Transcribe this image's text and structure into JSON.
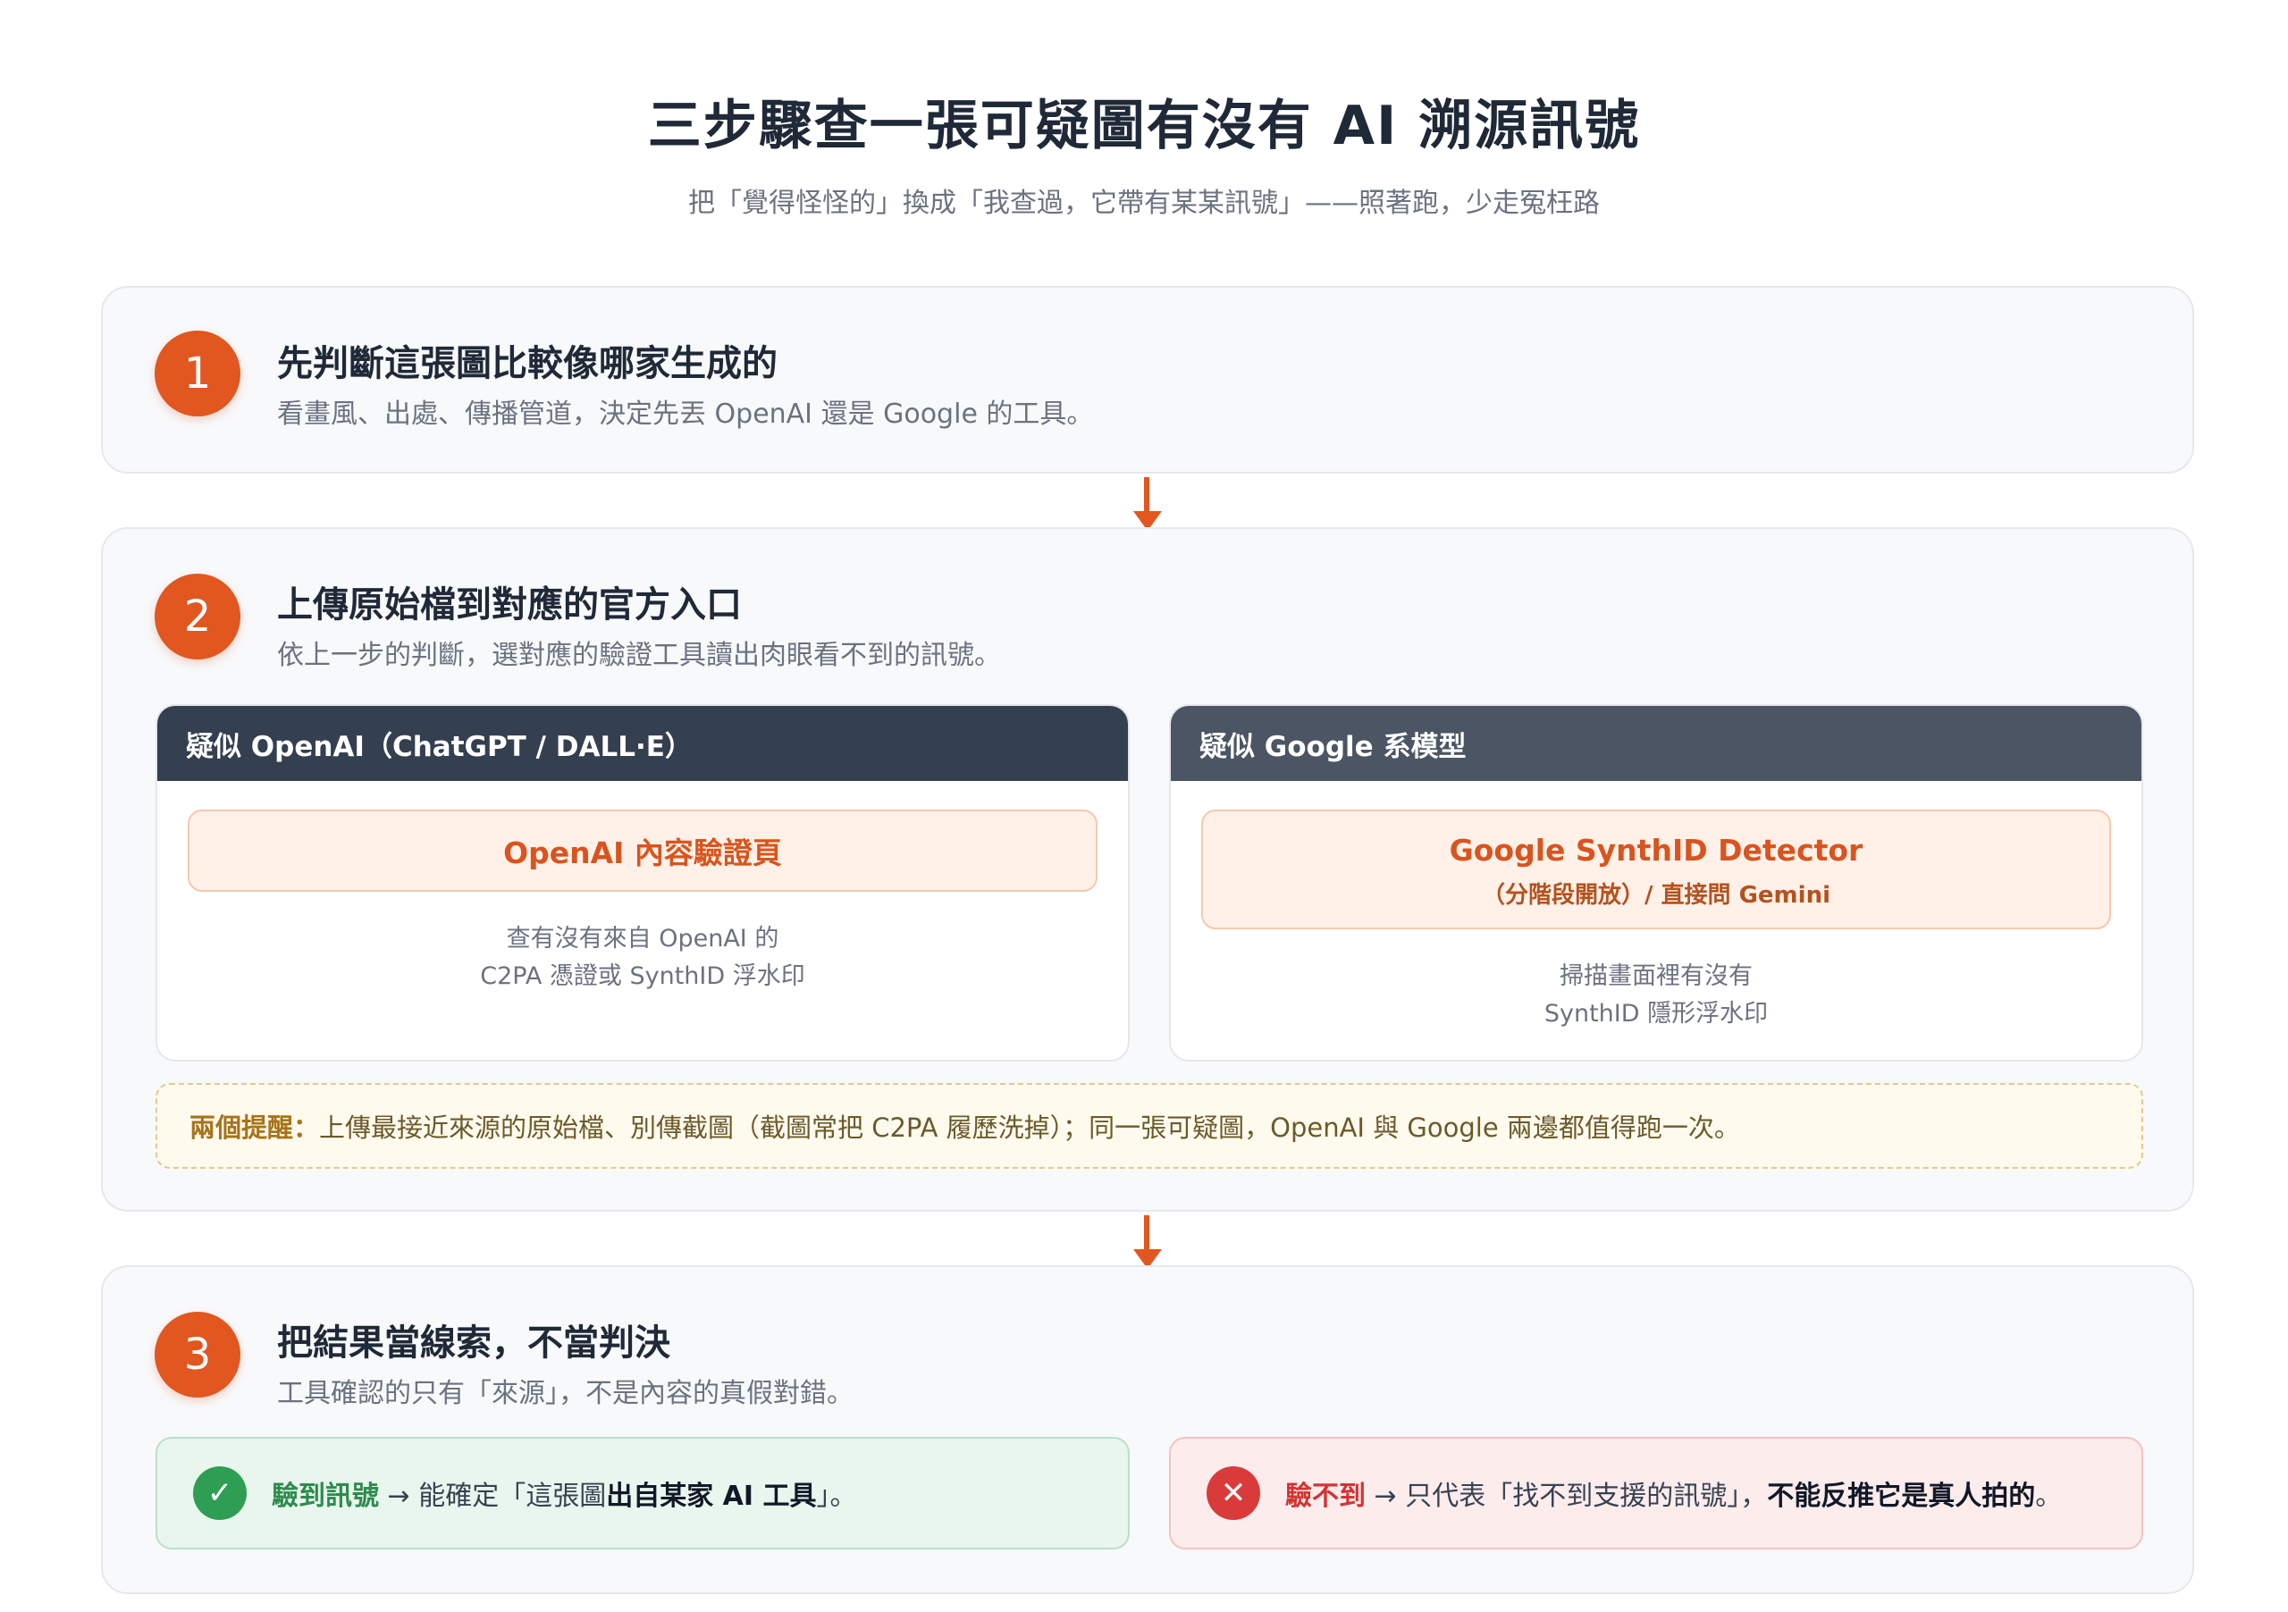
{
  "header": {
    "title": "三步驟查一張可疑圖有沒有 AI 溯源訊號",
    "subtitle": "把「覺得怪怪的」換成「我查過，它帶有某某訊號」——照著跑，少走冤枉路"
  },
  "steps": [
    {
      "number": "1",
      "title": "先判斷這張圖比較像哪家生成的",
      "desc": "看畫風、出處、傳播管道，決定先丟 OpenAI 還是 Google 的工具。"
    },
    {
      "number": "2",
      "title": "上傳原始檔到對應的官方入口",
      "desc": "依上一步的判斷，選對應的驗證工具讀出肉眼看不到的訊號。",
      "cards": [
        {
          "header": "疑似 OpenAI（ChatGPT / DALL·E）",
          "tool": "OpenAI 內容驗證頁",
          "note_line1": "查有沒有來自 OpenAI 的",
          "note_line2": "C2PA 憑證或 SynthID 浮水印"
        },
        {
          "header": "疑似 Google 系模型",
          "tool": "Google SynthID Detector",
          "tool_sub": "（分階段開放）/ 直接問 Gemini",
          "note_line1": "掃描畫面裡有沒有",
          "note_line2": "SynthID 隱形浮水印"
        }
      ],
      "reminder": {
        "lead": "兩個提醒：",
        "text": "上傳最接近來源的原始檔、別傳截圖（截圖常把 C2PA 履歷洗掉）；同一張可疑圖，OpenAI 與 Google 兩邊都值得跑一次。"
      }
    },
    {
      "number": "3",
      "title": "把結果當線索，不當判決",
      "desc": "工具確認的只有「來源」，不是內容的真假對錯。",
      "results": [
        {
          "icon": "check-icon",
          "keyword": "驗到訊號",
          "before": "→ 能確定「這張圖",
          "bold": "出自某家 AI 工具",
          "after": "」。"
        },
        {
          "icon": "cross-icon",
          "keyword": "驗不到",
          "before": "→ 只代表「找不到支援的訊號」，",
          "bold": "不能反推它是真人拍的",
          "after": "。"
        }
      ]
    }
  ],
  "colors": {
    "accent": "#e2561f",
    "success": "#2e9e55",
    "danger": "#d93a3a"
  }
}
